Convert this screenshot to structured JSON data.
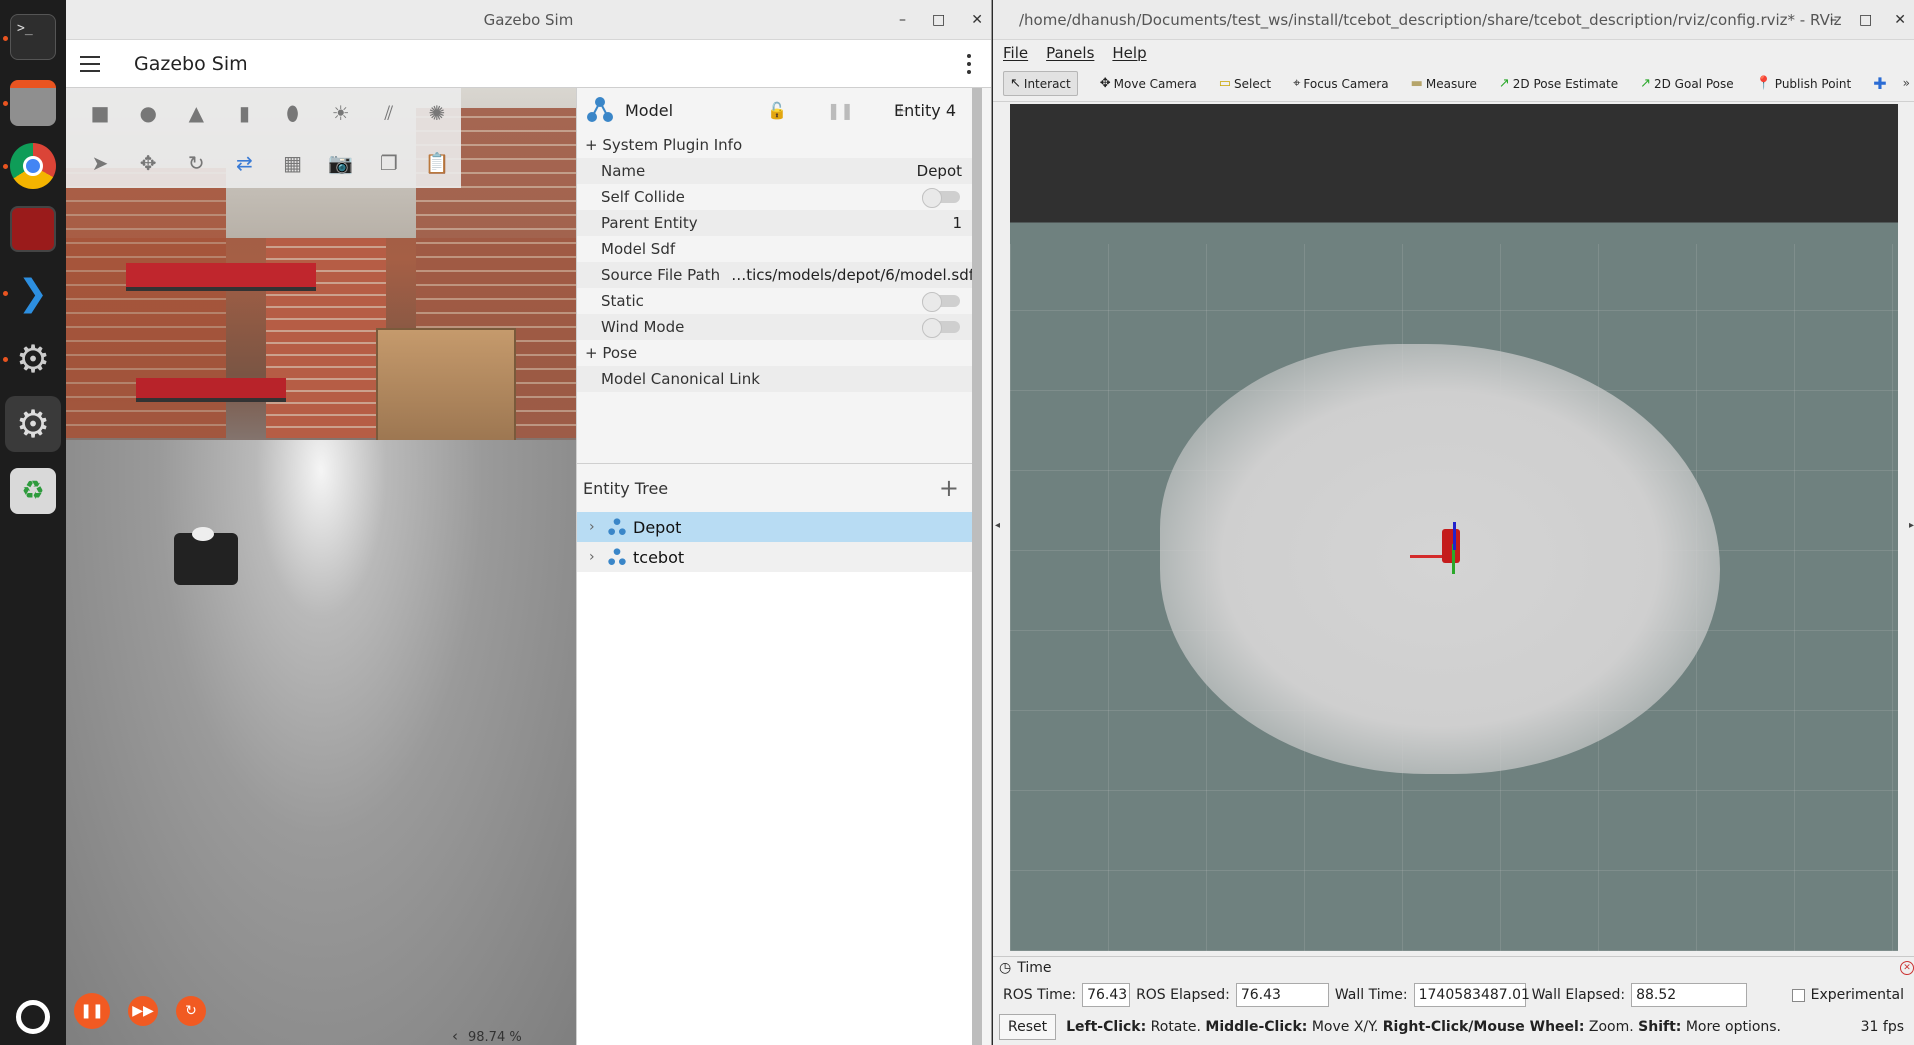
{
  "dock": {
    "items": [
      {
        "name": "terminal",
        "label": ">_"
      },
      {
        "name": "files",
        "label": ""
      },
      {
        "name": "chrome",
        "label": ""
      },
      {
        "name": "app-red",
        "label": ""
      },
      {
        "name": "vscode",
        "label": ""
      },
      {
        "name": "settings-1",
        "label": ""
      },
      {
        "name": "settings-2",
        "label": ""
      },
      {
        "name": "trash",
        "label": "♻"
      }
    ]
  },
  "gazebo": {
    "window_title": "Gazebo Sim",
    "app_title": "Gazebo Sim",
    "window_controls": {
      "minimize": "–",
      "maximize": "□",
      "close": "✕"
    },
    "toolbar_row1": [
      "box",
      "sphere",
      "cone",
      "cylinder",
      "capsule",
      "sun",
      "directional-light",
      "spot-light"
    ],
    "toolbar_row2": [
      "select",
      "translate",
      "rotate",
      "snap",
      "grid",
      "screenshot",
      "copy",
      "paste"
    ],
    "rtf": "98.74 %",
    "rtf_arrow": "‹",
    "component_inspector": {
      "title": "Model",
      "entity": "Entity 4",
      "rows": [
        {
          "key": "System Plugin Info",
          "value": "",
          "type": "expand"
        },
        {
          "key": "Name",
          "value": "Depot",
          "type": "text"
        },
        {
          "key": "Self Collide",
          "value": "",
          "type": "toggle"
        },
        {
          "key": "Parent Entity",
          "value": "1",
          "type": "text"
        },
        {
          "key": "Model Sdf",
          "value": "",
          "type": "text"
        },
        {
          "key": "Source File Path",
          "value": "…tics/models/depot/6/model.sdf",
          "type": "text"
        },
        {
          "key": "Static",
          "value": "",
          "type": "toggle"
        },
        {
          "key": "Wind Mode",
          "value": "",
          "type": "toggle"
        },
        {
          "key": "Pose",
          "value": "",
          "type": "expand"
        },
        {
          "key": "Model Canonical Link",
          "value": "",
          "type": "text"
        }
      ]
    },
    "entity_tree": {
      "title": "Entity Tree",
      "items": [
        {
          "label": "Depot",
          "selected": true
        },
        {
          "label": "tcebot",
          "selected": false
        }
      ]
    }
  },
  "rviz": {
    "window_title": "/home/dhanush/Documents/test_ws/install/tcebot_description/share/tcebot_description/rviz/config.rviz* - RViz",
    "menu": [
      "File",
      "Panels",
      "Help"
    ],
    "tools": [
      {
        "label": "Interact",
        "icon": "↖",
        "active": true
      },
      {
        "label": "Move Camera",
        "icon": "✥",
        "active": false
      },
      {
        "label": "Select",
        "icon": "▭",
        "active": false
      },
      {
        "label": "Focus Camera",
        "icon": "⌖",
        "active": false
      },
      {
        "label": "Measure",
        "icon": "▬",
        "active": false
      },
      {
        "label": "2D Pose Estimate",
        "icon": "↗",
        "active": false
      },
      {
        "label": "2D Goal Pose",
        "icon": "↗",
        "active": false
      },
      {
        "label": "Publish Point",
        "icon": "📍",
        "active": false
      }
    ],
    "time_panel": {
      "title": "Time",
      "ros_time_label": "ROS Time:",
      "ros_time": "76.43",
      "ros_elapsed_label": "ROS Elapsed:",
      "ros_elapsed": "76.43",
      "wall_time_label": "Wall Time:",
      "wall_time": "1740583487.01",
      "wall_elapsed_label": "Wall Elapsed:",
      "wall_elapsed": "88.52",
      "experimental_label": "Experimental"
    },
    "status": {
      "reset_label": "Reset",
      "hint_1b": "Left-Click:",
      "hint_1": " Rotate.",
      "hint_2b": "Middle-Click:",
      "hint_2": " Move X/Y.",
      "hint_3b": "Right-Click/Mouse Wheel:",
      "hint_3": " Zoom.",
      "hint_4b": "Shift:",
      "hint_4": " More options.",
      "fps": "31 fps"
    },
    "colors": {
      "grid_bg": "#6f817f",
      "viewport_bg": "#303030"
    }
  }
}
